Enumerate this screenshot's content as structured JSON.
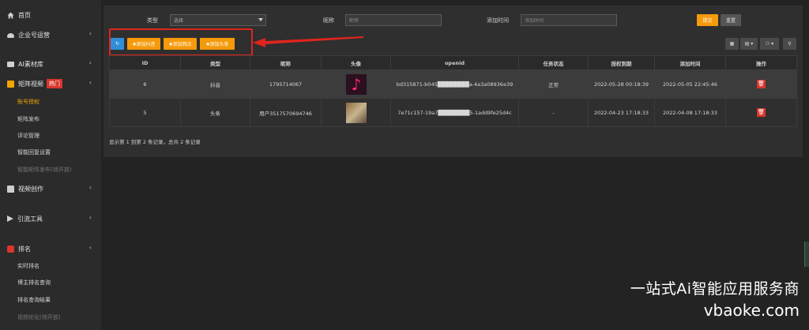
{
  "sidebar": {
    "items": [
      {
        "label": "首页"
      },
      {
        "label": "企业号运营"
      },
      {
        "label": "AI素材库"
      },
      {
        "label": "矩阵视频",
        "badge": "热门"
      },
      {
        "label": "视频创作"
      },
      {
        "label": "引流工具"
      },
      {
        "label": "排名"
      }
    ],
    "matrix_sub": [
      "账号授权",
      "矩阵发布",
      "评论管理",
      "智能回复设置",
      "智能矩阵发布(待开放)"
    ],
    "rank_sub": [
      "实时排名",
      "博主排名查询",
      "排名查询结果",
      "视频优化(待开放)"
    ],
    "chevron": "‹"
  },
  "filters": {
    "type_label": "类型",
    "type_value": "选择",
    "nickname_label": "昵称",
    "nickname_placeholder": "昵称",
    "time_label": "添加时间",
    "time_placeholder": "添加时间",
    "submit_label": "提交",
    "reset_label": "重置"
  },
  "toolbar": {
    "refresh_icon": "↻",
    "add_douyin": "✚添加抖音",
    "add_xigua": "✚添加西瓜",
    "add_toutiao": "✚添加头条",
    "view_icons": [
      "▦",
      "▤ ▾",
      "⚇ ▾",
      "⚲"
    ]
  },
  "table": {
    "headers": [
      "ID",
      "类型",
      "昵称",
      "头像",
      "openid",
      "任务状态",
      "授权到期",
      "添加时间",
      "操作"
    ],
    "rows": [
      {
        "id": "6",
        "type": "抖音",
        "nickname": "1795714067",
        "avatar": "tiktok-logo",
        "openid": "bd315871-b045████████a-4a3a08936e39",
        "status": "正常",
        "expire": "2022-05-28 00:18:39",
        "added": "2022-05-05 22:45:46"
      },
      {
        "id": "5",
        "type": "头条",
        "nickname": "用户3517570694746",
        "avatar": "dog-photo",
        "openid": "7e71c157-19a7████████5-1add9fe25d4c",
        "status": "-",
        "expire": "2022-04-23 17:18:33",
        "added": "2022-04-08 17:18:33"
      }
    ],
    "delete_icon": "🗑"
  },
  "pagination_text": "显示第 1 到第 2 条记录，总共 2 条记录",
  "watermark": {
    "line1": "一站式Ai智能应用服务商",
    "line2": "vbaoke.com"
  },
  "colors": {
    "accent": "#f59a0b",
    "danger": "#d9362c",
    "highlight_border": "#e0251d",
    "background": "#232323"
  }
}
